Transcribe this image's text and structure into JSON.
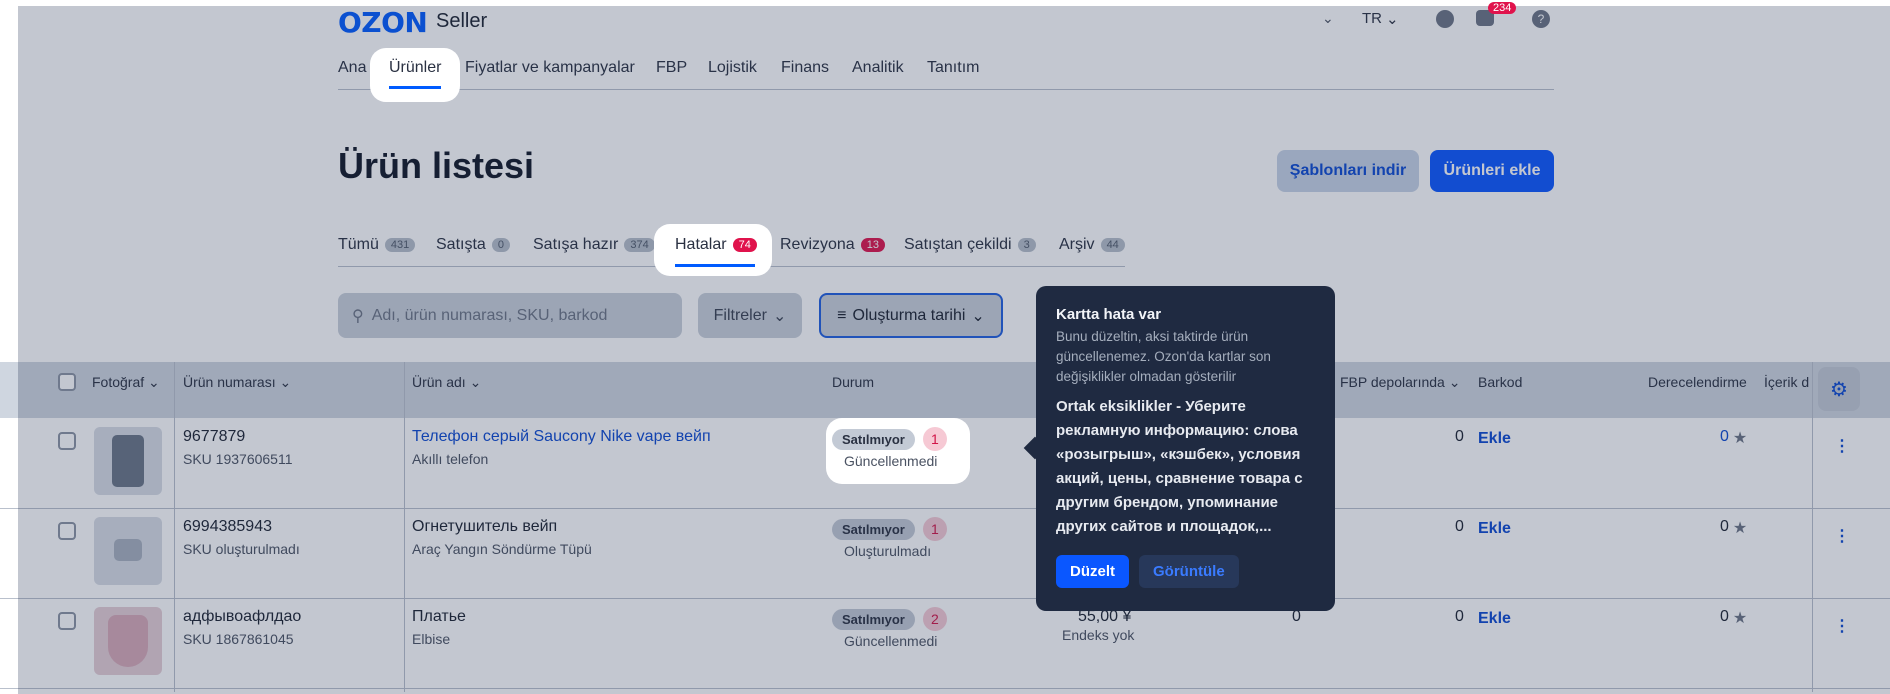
{
  "header": {
    "logo": "OZON",
    "logo_sub": "Seller",
    "lang": "TR",
    "notif_count": "234",
    "nav": [
      "Ana",
      "Ürünler",
      "Fiyatlar ve kampanyalar",
      "FBP",
      "Lojistik",
      "Finans",
      "Analitik",
      "Tanıtım"
    ]
  },
  "page": {
    "title": "Ürün listesi",
    "btn_templates": "Şablonları indir",
    "btn_add": "Ürünleri ekle"
  },
  "tabs": [
    {
      "label": "Tümü",
      "count": "431"
    },
    {
      "label": "Satışta",
      "count": "0"
    },
    {
      "label": "Satışa hazır",
      "count": "374"
    },
    {
      "label": "Hatalar",
      "count": "74"
    },
    {
      "label": "Revizyona",
      "count": "13"
    },
    {
      "label": "Satıştan çekildi",
      "count": "3"
    },
    {
      "label": "Arşiv",
      "count": "44"
    }
  ],
  "toolbar": {
    "search_placeholder": "Adı, ürün numarası, SKU, barkod",
    "filters": "Filtreler",
    "sort": "Oluşturma tarihi"
  },
  "table": {
    "headers": [
      "Fotoğraf",
      "Ürün numarası",
      "Ürün adı",
      "Durum",
      "FBP depolarında",
      "Barkod",
      "Derecelendirme",
      "İçerik d"
    ],
    "rows": [
      {
        "num": "9677879",
        "sku": "SKU 1937606511",
        "name": "Телефон серый Saucony Nike vape вейп",
        "cat": "Akıllı telefon",
        "status": "Satılmıyor",
        "errors": "1",
        "sub": "Güncellenmedi",
        "price": "",
        "price_sub": "",
        "col5": "",
        "fbp": "0",
        "barcode": "Ekle",
        "rating": "0"
      },
      {
        "num": "6994385943",
        "sku": "SKU oluşturulmadı",
        "name": "Огнетушитель вейп",
        "cat": "Araç Yangın Söndürme Tüpü",
        "status": "Satılmıyor",
        "errors": "1",
        "sub": "Oluşturulmadı",
        "price": "",
        "price_sub": "",
        "col5": "",
        "fbp": "0",
        "barcode": "Ekle",
        "rating": "0"
      },
      {
        "num": "адфывоафлдао",
        "sku": "SKU 1867861045",
        "name": "Платье",
        "cat": "Elbise",
        "status": "Satılmıyor",
        "errors": "2",
        "sub": "Güncellenmedi",
        "price": "55,00 ¥",
        "price_sub": "Endeks yok",
        "col5": "0",
        "fbp": "0",
        "barcode": "Ekle",
        "rating": "0"
      }
    ]
  },
  "popover": {
    "title": "Kartta hata var",
    "subtitle": "Bunu düzeltin, aksi taktirde ürün güncellenemez. Ozon'da kartlar son değişiklikler olmadan gösterilir",
    "body": "Ortak eksiklikler - Уберите рекламную информацию: слова «розыгрыш», «кэшбек», условия акций, цены, сравнение товара с другим брендом, упоминание других сайтов и площадок,...",
    "btn_fix": "Düzelt",
    "btn_view": "Görüntüle"
  },
  "colors": {
    "accent": "#005bff",
    "error": "#e0134c",
    "popover": "#1f2a41"
  }
}
